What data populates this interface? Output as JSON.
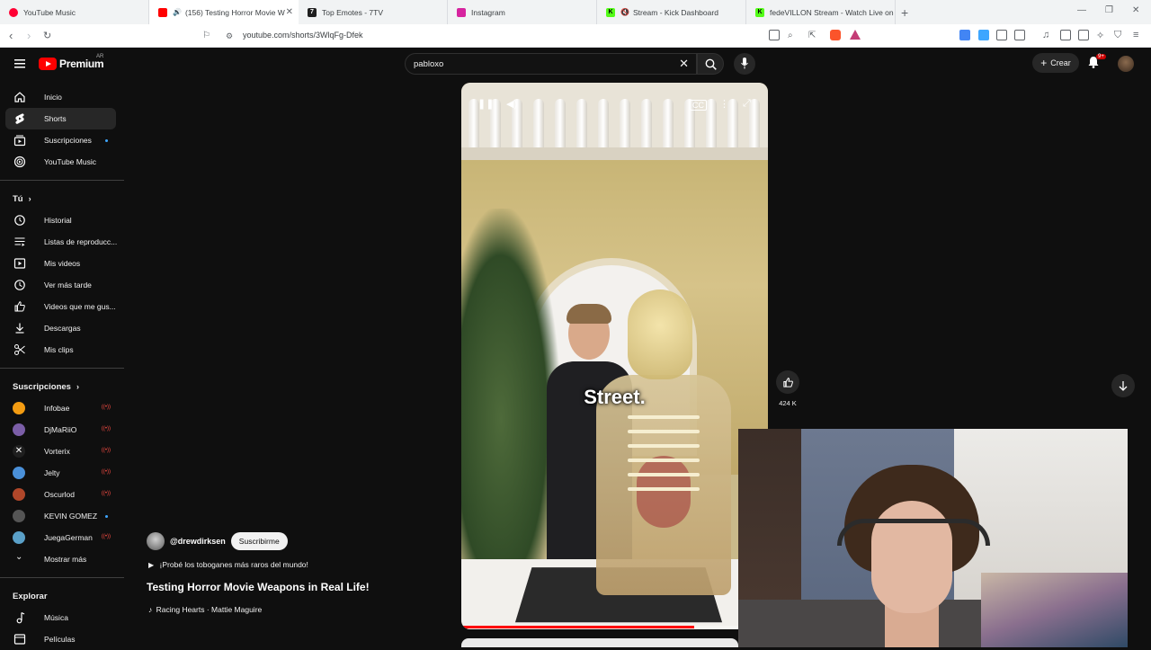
{
  "browser": {
    "tabs": [
      {
        "title": "YouTube Music",
        "favicon_color": "#ff0033",
        "active": false
      },
      {
        "title": "(156) Testing Horror Movie W",
        "favicon_color": "#ff0000",
        "active": true
      },
      {
        "title": "Top Emotes - 7TV",
        "favicon_color": "#1f1f1f",
        "active": false
      },
      {
        "title": "Instagram",
        "favicon_color": "#d6249f",
        "active": false
      },
      {
        "title": "Stream - Kick Dashboard",
        "favicon_color": "#53fc18",
        "active": false
      },
      {
        "title": "fedeVILLON Stream - Watch Live on",
        "favicon_color": "#53fc18",
        "active": false
      }
    ],
    "new_tab": "+",
    "url": "youtube.com/shorts/3WlqFg-Dfek"
  },
  "youtube": {
    "logo_text": "Premium",
    "logo_region": "AR",
    "search_query": "pabloxo",
    "create_label": "Crear",
    "notifications_badge": "9+",
    "sidebar": {
      "main": [
        {
          "label": "Inicio",
          "icon": "home-icon"
        },
        {
          "label": "Shorts",
          "icon": "shorts-icon",
          "active": true
        },
        {
          "label": "Suscripciones",
          "icon": "subscriptions-icon",
          "dot": true
        },
        {
          "label": "YouTube Music",
          "icon": "youtube-music-icon"
        }
      ],
      "you_heading": "Tú",
      "you_items": [
        {
          "label": "Historial",
          "icon": "history-icon"
        },
        {
          "label": "Listas de reproducc...",
          "icon": "playlists-icon"
        },
        {
          "label": "Mis videos",
          "icon": "my-videos-icon"
        },
        {
          "label": "Ver más tarde",
          "icon": "watch-later-icon"
        },
        {
          "label": "Videos que me gus...",
          "icon": "liked-videos-icon"
        },
        {
          "label": "Descargas",
          "icon": "downloads-icon"
        },
        {
          "label": "Mis clips",
          "icon": "clips-icon"
        }
      ],
      "subs_heading": "Suscripciones",
      "subscriptions": [
        {
          "name": "Infobae",
          "color": "#f39c12",
          "status": "live"
        },
        {
          "name": "DjMaRiiO",
          "color": "#7b5ea7",
          "status": "live"
        },
        {
          "name": "Vorterix",
          "color": "#1f1f1f",
          "status": "live"
        },
        {
          "name": "Jelty",
          "color": "#4a90d9",
          "status": "live"
        },
        {
          "name": "Oscurlod",
          "color": "#b0472a",
          "status": "live"
        },
        {
          "name": "KEVIN GOMEZ",
          "color": "#555555",
          "status": "dot"
        },
        {
          "name": "JuegaGerman",
          "color": "#5aa0c8",
          "status": "live"
        }
      ],
      "show_more": "Mostrar más",
      "explore_heading": "Explorar",
      "explore_items": [
        {
          "label": "Música",
          "icon": "music-icon"
        },
        {
          "label": "Películas",
          "icon": "movies-icon"
        }
      ]
    },
    "short": {
      "channel": "@drewdirksen",
      "subscribe_label": "Suscribirme",
      "playlist": "¡Probé los toboganes más raros del mundo!",
      "title": "Testing Horror Movie Weapons in Real Life!",
      "music": "Racing Hearts · Mattie Maguire",
      "caption": "Street.",
      "likes": "424 K",
      "progress": 0.76
    }
  }
}
